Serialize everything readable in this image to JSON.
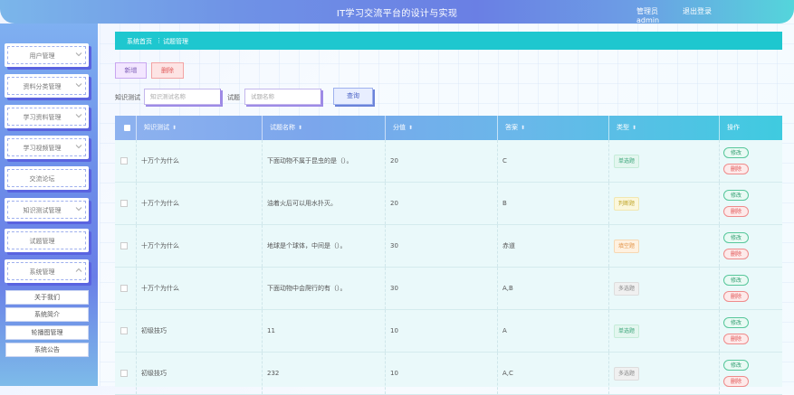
{
  "header": {
    "title": "IT学习交流平台的设计与实现",
    "user": "管理员 admin",
    "logout": "退出登录"
  },
  "sidebar": {
    "menus": [
      {
        "label": "用户管理"
      },
      {
        "label": "资料分类管理"
      },
      {
        "label": "学习资料管理"
      },
      {
        "label": "学习视频管理"
      },
      {
        "label": "交流论坛"
      },
      {
        "label": "知识测试管理"
      },
      {
        "label": "试题管理"
      },
      {
        "label": "系统管理"
      }
    ],
    "submenus": [
      {
        "label": "关于我们"
      },
      {
        "label": "系统简介"
      },
      {
        "label": "轮播图管理"
      },
      {
        "label": "系统公告"
      }
    ]
  },
  "breadcrumb": {
    "home": "系统首页",
    "sep": "⋮",
    "current": "试题管理"
  },
  "toolbar": {
    "add": "新增",
    "delete": "删除"
  },
  "search": {
    "label1": "知识测试",
    "placeholder1": "知识测试名称",
    "label2": "试题",
    "placeholder2": "试题名称",
    "query": "查询"
  },
  "table": {
    "headers": [
      "知识测试",
      "试题名称",
      "分值",
      "答案",
      "类型",
      "操作"
    ],
    "rows": [
      {
        "test": "十万个为什么",
        "name": "下面动物不属于昆虫的是（）。",
        "score": "20",
        "answer": "C",
        "type": "单选题",
        "tag": "single"
      },
      {
        "test": "十万个为什么",
        "name": "油着火后可以用水扑灭。",
        "score": "20",
        "answer": "B",
        "type": "判断题",
        "tag": "judge"
      },
      {
        "test": "十万个为什么",
        "name": "地球是个球体，中间是（）。",
        "score": "30",
        "answer": "赤道",
        "type": "填空题",
        "tag": "fill"
      },
      {
        "test": "十万个为什么",
        "name": "下面动物中会爬行的有（）。",
        "score": "30",
        "answer": "A,B",
        "type": "多选题",
        "tag": "multi"
      },
      {
        "test": "初级技巧",
        "name": "11",
        "score": "10",
        "answer": "A",
        "type": "单选题",
        "tag": "single"
      },
      {
        "test": "初级技巧",
        "name": "232",
        "score": "10",
        "answer": "A,C",
        "type": "多选题",
        "tag": "multi"
      }
    ],
    "edit_label": "修改",
    "delete_label": "删除"
  }
}
